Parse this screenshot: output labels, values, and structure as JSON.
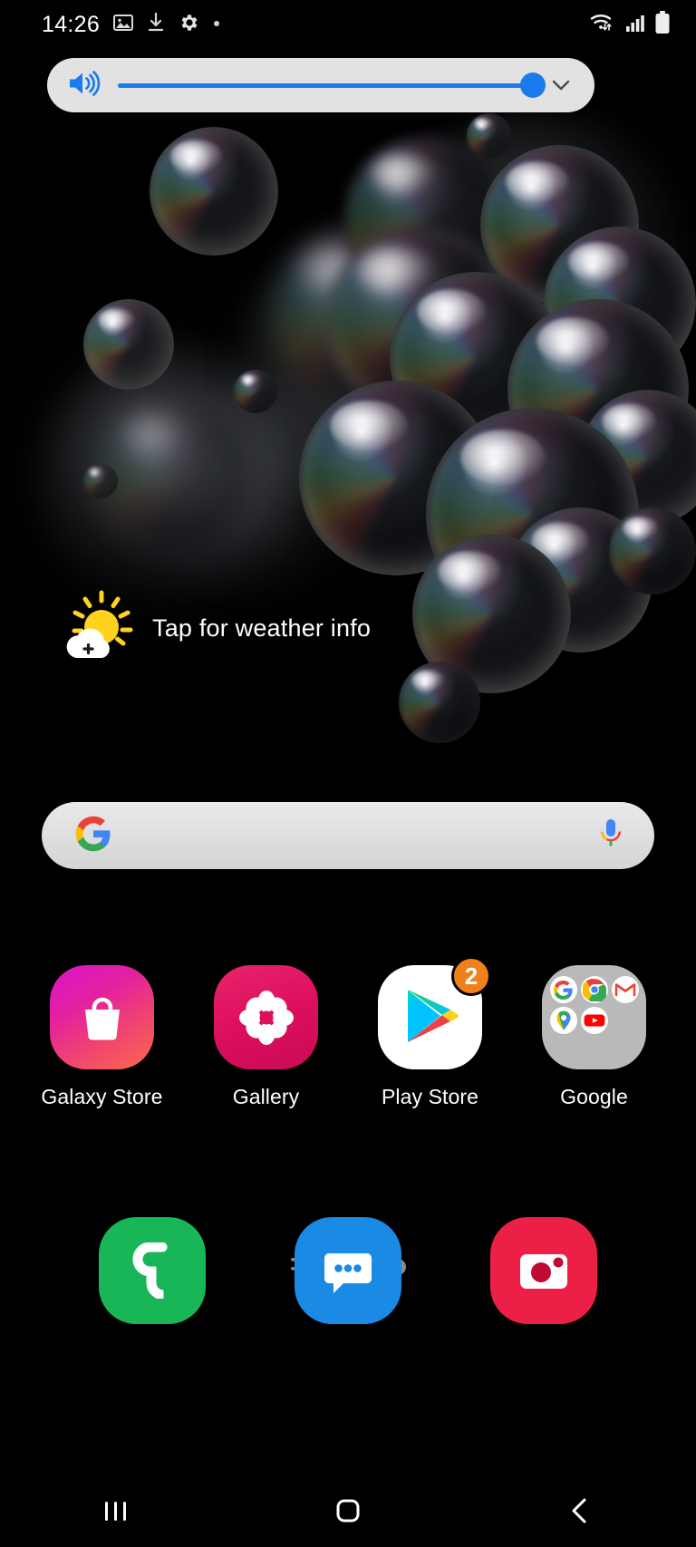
{
  "status_bar": {
    "time": "14:26",
    "left_icons": [
      "image-icon",
      "download-icon",
      "settings-gear-icon",
      "dot-icon"
    ],
    "right_icons": [
      "wifi-icon",
      "signal-icon",
      "battery-icon"
    ]
  },
  "volume_panel": {
    "speaker_icon": "volume-up-icon",
    "level_percent": 100,
    "expand_icon": "chevron-down-icon",
    "accent_color": "#1a7bec",
    "background_color": "#e2e2e3"
  },
  "weather_widget": {
    "text": "Tap for weather info",
    "icon": "sun-behind-cloud-icon",
    "sun_color": "#ffd21e",
    "cloud_color": "#ffffff"
  },
  "search_bar": {
    "logo_icon": "google-g-icon",
    "mic_icon": "microphone-icon",
    "query": "",
    "placeholder": ""
  },
  "apps": [
    {
      "label": "Galaxy Store",
      "icon": "galaxy-store-icon",
      "badge": ""
    },
    {
      "label": "Gallery",
      "icon": "gallery-icon",
      "badge": ""
    },
    {
      "label": "Play Store",
      "icon": "play-store-icon",
      "badge": "2"
    },
    {
      "label": "Google",
      "icon": "google-folder-icon",
      "badge": ""
    }
  ],
  "folder_apps": [
    "google-search-icon",
    "chrome-icon",
    "gmail-icon",
    "maps-icon",
    "youtube-icon"
  ],
  "page_indicator": {
    "items": [
      "app-list-icon",
      "home-icon",
      "page-dot-icon"
    ],
    "active_index": 1
  },
  "dock": [
    {
      "name": "Phone",
      "icon": "phone-icon",
      "color": "#18b657"
    },
    {
      "name": "Messages",
      "icon": "messages-icon",
      "color": "#1a8ae5"
    },
    {
      "name": "Camera",
      "icon": "camera-icon",
      "color": "#ec1f47"
    }
  ],
  "nav_bar": {
    "recents_icon": "recents-icon",
    "home_icon": "home-square-icon",
    "back_icon": "back-chevron-icon"
  },
  "badge_color": "#f0801a"
}
